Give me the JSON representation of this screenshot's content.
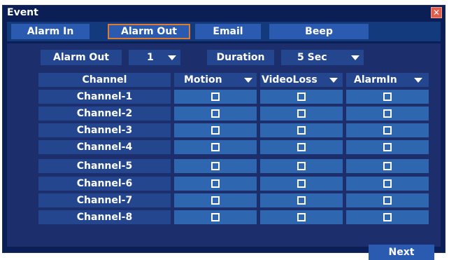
{
  "window": {
    "title": "Event",
    "close_glyph": "✕"
  },
  "tabs": [
    {
      "label": "Alarm In",
      "active": false
    },
    {
      "label": "Alarm Out",
      "active": true
    },
    {
      "label": "Email",
      "active": false
    },
    {
      "label": "Beep",
      "active": false
    }
  ],
  "controls": {
    "alarm_out_label": "Alarm Out",
    "alarm_out_value": "1",
    "duration_label": "Duration",
    "duration_value": "5 Sec"
  },
  "table": {
    "headers": [
      "Channel",
      "Motion",
      "VideoLoss",
      "AlarmIn"
    ],
    "rows": [
      {
        "channel": "Channel-1",
        "motion": false,
        "videoloss": false,
        "alarmin": false
      },
      {
        "channel": "Channel-2",
        "motion": false,
        "videoloss": false,
        "alarmin": false
      },
      {
        "channel": "Channel-3",
        "motion": false,
        "videoloss": false,
        "alarmin": false
      },
      {
        "channel": "Channel-4",
        "motion": false,
        "videoloss": false,
        "alarmin": false
      },
      {
        "channel": "Channel-5",
        "motion": false,
        "videoloss": false,
        "alarmin": false
      },
      {
        "channel": "Channel-6",
        "motion": false,
        "videoloss": false,
        "alarmin": false
      },
      {
        "channel": "Channel-7",
        "motion": false,
        "videoloss": false,
        "alarmin": false
      },
      {
        "channel": "Channel-8",
        "motion": false,
        "videoloss": false,
        "alarmin": false
      }
    ]
  },
  "footer": {
    "next_label": "Next"
  },
  "colors": {
    "window_bg": "#0b1f56",
    "panel_bg": "#1c2f6c",
    "cell_bg": "#24468f",
    "checkbox_cell_bg": "#2e66b0",
    "active_tab_border": "#e07a2e",
    "close_button": "#e25c4c"
  },
  "icons": {
    "close": "close-icon",
    "dropdown": "chevron-down-icon",
    "checkbox": "checkbox-icon"
  }
}
